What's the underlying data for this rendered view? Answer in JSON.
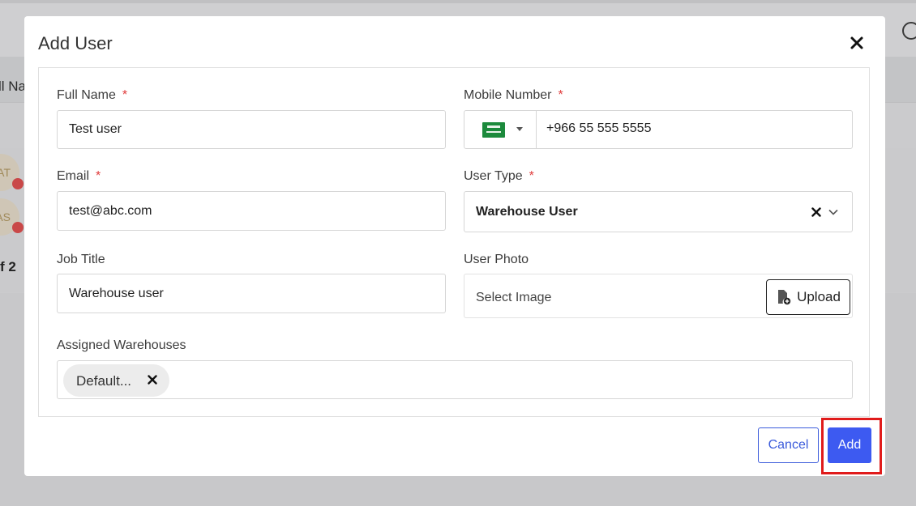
{
  "background": {
    "column_header_fragment": "ll Na",
    "avatars": [
      "AT",
      "AS"
    ],
    "pager_fragment": "f 2"
  },
  "modal": {
    "title": "Add User",
    "close_icon": "close-icon",
    "fields": {
      "full_name": {
        "label": "Full Name",
        "required_mark": "*",
        "value": "Test user"
      },
      "mobile_number": {
        "label": "Mobile Number",
        "required_mark": "*",
        "country_flag": "saudi-arabia-flag",
        "value": "+966 55 555 5555"
      },
      "email": {
        "label": "Email",
        "required_mark": "*",
        "value": "test@abc.com"
      },
      "user_type": {
        "label": "User Type",
        "required_mark": "*",
        "value": "Warehouse User"
      },
      "job_title": {
        "label": "Job Title",
        "value": "Warehouse user"
      },
      "user_photo": {
        "label": "User Photo",
        "placeholder": "Select Image",
        "upload_label": "Upload"
      },
      "assigned_warehouses": {
        "label": "Assigned Warehouses",
        "chips": [
          "Default..."
        ]
      }
    },
    "buttons": {
      "cancel": "Cancel",
      "add": "Add"
    }
  },
  "colors": {
    "primary": "#3d5af1",
    "required": "#e03b3b",
    "highlight": "#e01b1b",
    "overlay": "#c8c8ca"
  }
}
